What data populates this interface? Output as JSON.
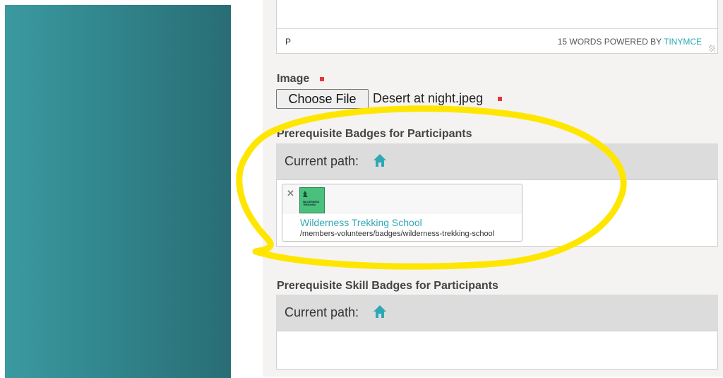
{
  "editor": {
    "status_path": "P",
    "word_count": "15 WORDS",
    "powered_by": "POWERED BY",
    "brand": "TINYMCE"
  },
  "image_field": {
    "label": "Image",
    "choose_button": "Choose File",
    "file_name": "Desert at night.jpeg"
  },
  "prereq_badges": {
    "label": "Prerequisite Badges for Participants",
    "current_path_label": "Current path:",
    "items": [
      {
        "title": "Wilderness Trekking School",
        "path": "/members-volunteers/badges/wilderness-trekking-school",
        "thumb_text": "WILDERNESS TREKKING"
      }
    ]
  },
  "prereq_skill_badges": {
    "label": "Prerequisite Skill Badges for Participants",
    "current_path_label": "Current path:"
  },
  "colors": {
    "accent": "#2fa8b6",
    "required_marker": "#e8333a",
    "highlight_annotation": "#ffe600",
    "sidebar": "#2f858c"
  },
  "icons": {
    "home": "home-icon",
    "remove": "close-icon"
  }
}
